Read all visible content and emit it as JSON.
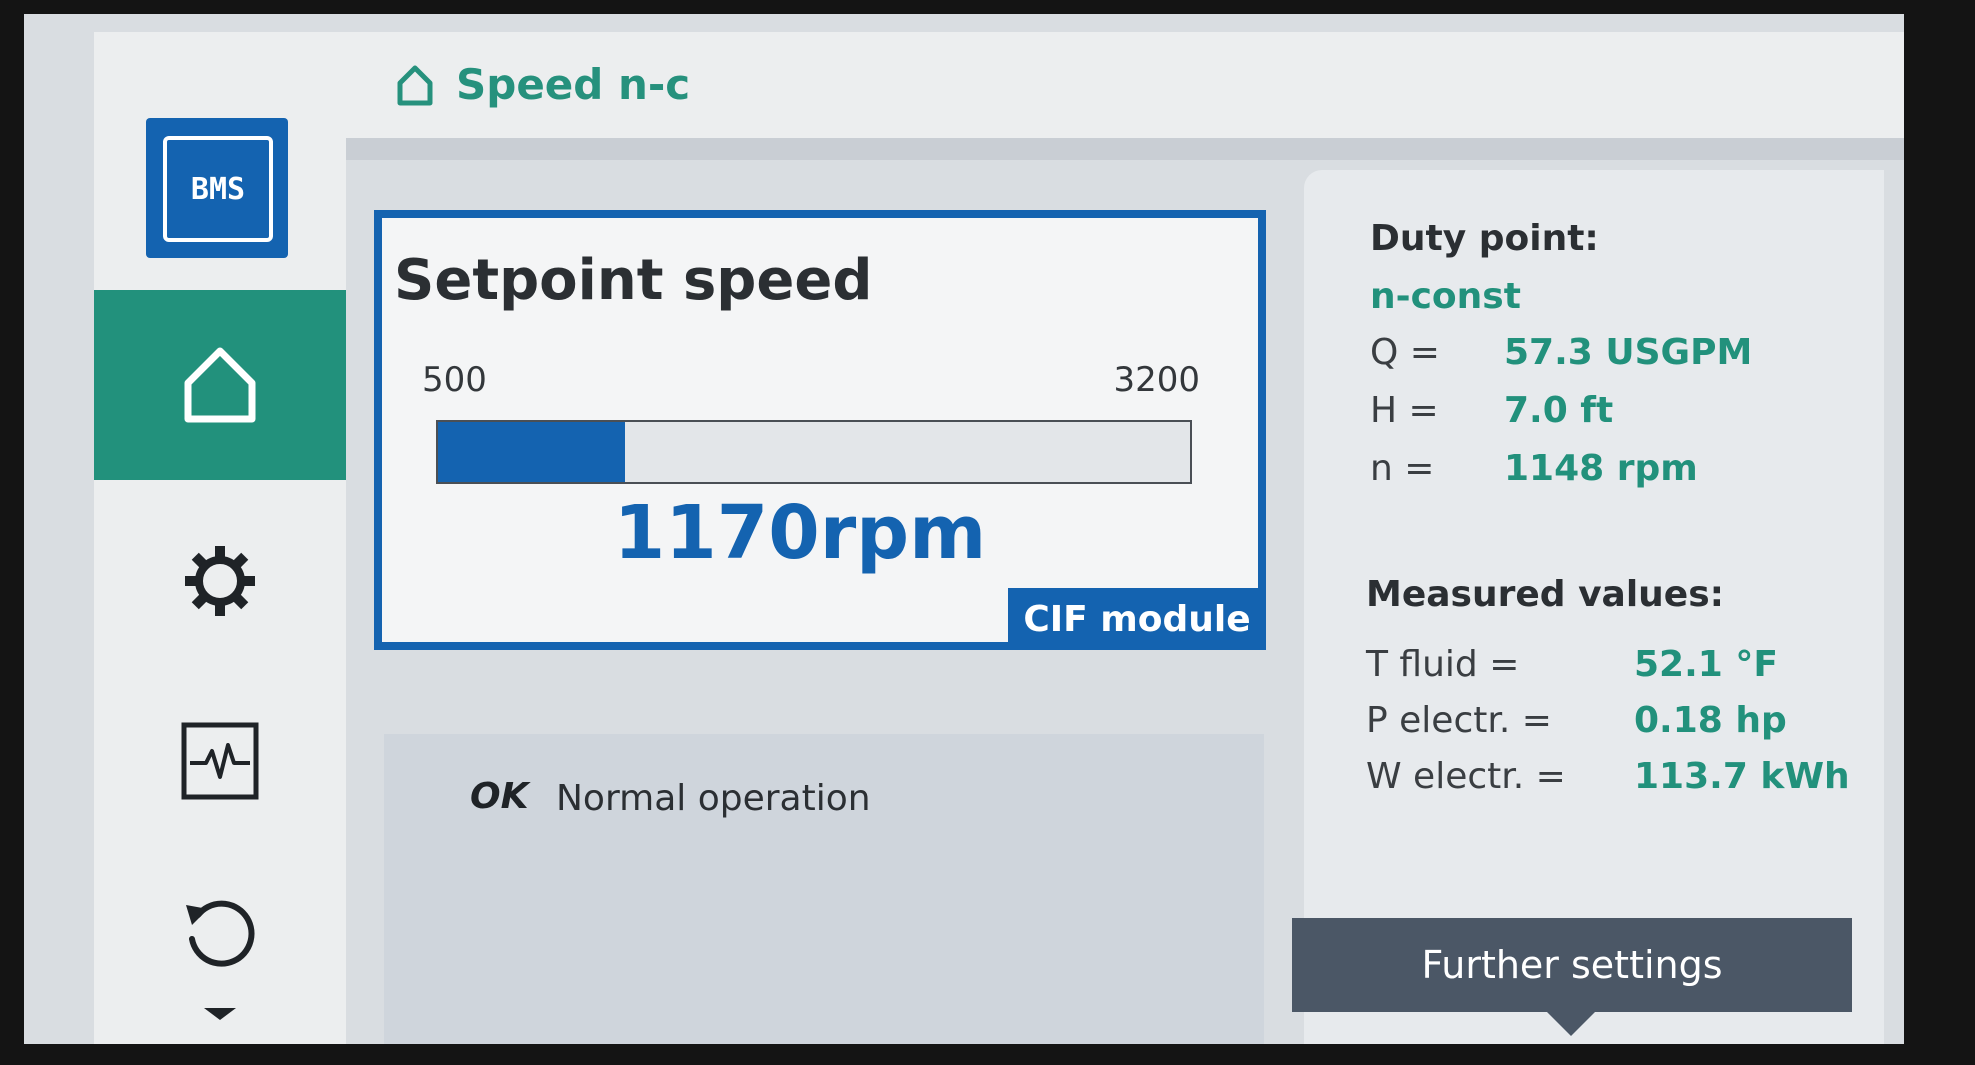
{
  "header": {
    "title": "Speed n-c",
    "icon": "home-outline-icon"
  },
  "sidebar": {
    "bms_label": "BMS",
    "items": [
      {
        "name": "home",
        "icon": "home-icon",
        "active": true
      },
      {
        "name": "settings",
        "icon": "gear-icon"
      },
      {
        "name": "diagnostics",
        "icon": "pulse-monitor-icon"
      },
      {
        "name": "restore",
        "icon": "undo-icon"
      },
      {
        "name": "more",
        "icon": "chevron-down-icon"
      }
    ]
  },
  "setpoint": {
    "title": "Setpoint speed",
    "min_label": "500",
    "max_label": "3200",
    "min": 500,
    "max": 3200,
    "value": 1170,
    "value_label": "1170rpm",
    "source_tag": "CIF module"
  },
  "status": {
    "code": "OK",
    "text": "Normal operation"
  },
  "duty_point": {
    "heading": "Duty point:",
    "mode": "n-const",
    "rows": [
      {
        "label": "Q =",
        "value": "57.3 USGPM"
      },
      {
        "label": "H =",
        "value": "7.0 ft"
      },
      {
        "label": "n =",
        "value": "1148 rpm"
      }
    ]
  },
  "measured": {
    "heading": "Measured values:",
    "rows": [
      {
        "label": "T fluid =",
        "value": "52.1 °F"
      },
      {
        "label": "P electr. =",
        "value": "0.18 hp"
      },
      {
        "label": "W electr. =",
        "value": "113.7 kWh"
      }
    ]
  },
  "further_settings": {
    "label": "Further settings"
  },
  "colors": {
    "accent_blue": "#1463b0",
    "accent_green": "#22917c",
    "button_gray": "#4b5766"
  }
}
